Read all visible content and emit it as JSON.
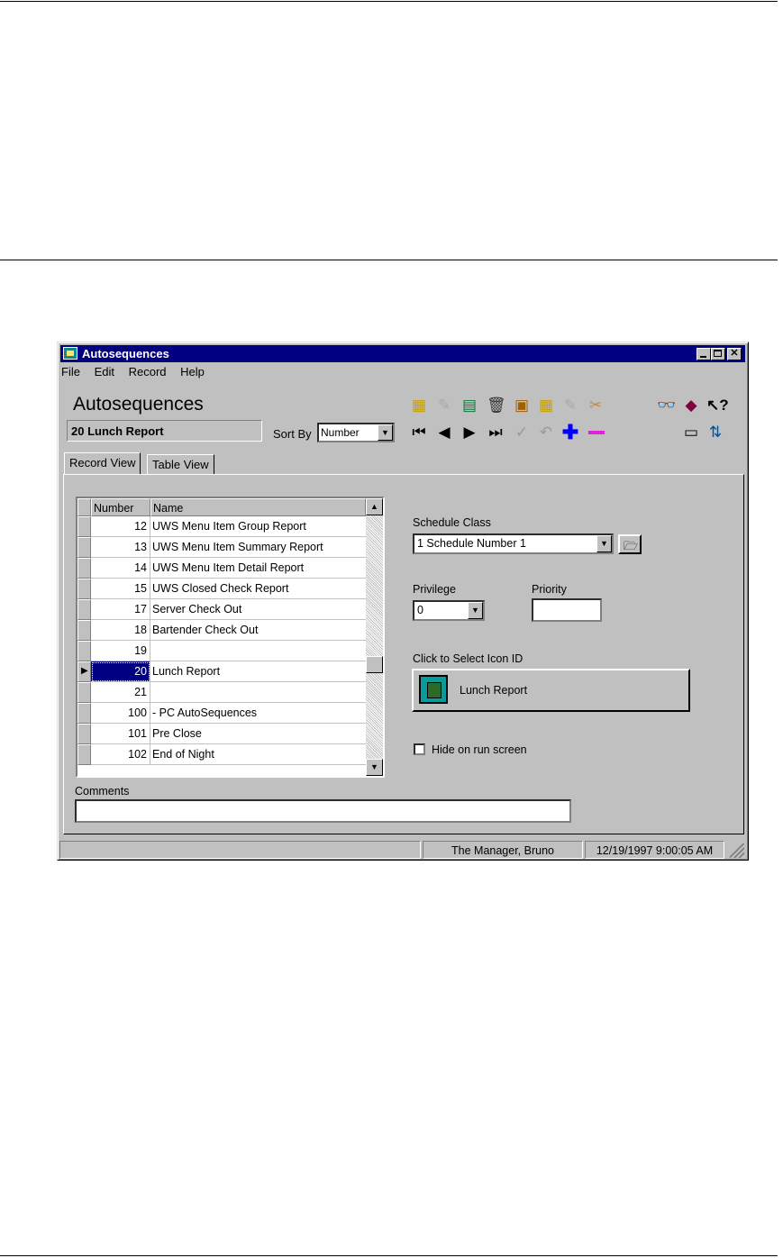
{
  "window": {
    "title": "Autosequences"
  },
  "menu": [
    "File",
    "Edit",
    "Record",
    "Help"
  ],
  "header": {
    "title": "Autosequences",
    "current_record": "20 Lunch Report",
    "sort_label": "Sort By",
    "sort_value": "Number"
  },
  "tabs": [
    {
      "label": "Record View",
      "active": true
    },
    {
      "label": "Table View",
      "active": false
    }
  ],
  "grid": {
    "columns": [
      "Number",
      "Name"
    ],
    "rows": [
      {
        "number": "12",
        "name": "UWS Menu Item Group Report"
      },
      {
        "number": "13",
        "name": "UWS Menu Item Summary Report"
      },
      {
        "number": "14",
        "name": "UWS Menu Item Detail Report"
      },
      {
        "number": "15",
        "name": "UWS Closed Check Report"
      },
      {
        "number": "17",
        "name": "Server Check Out"
      },
      {
        "number": "18",
        "name": "Bartender Check Out"
      },
      {
        "number": "19",
        "name": ""
      },
      {
        "number": "20",
        "name": "Lunch Report",
        "selected": true
      },
      {
        "number": "21",
        "name": ""
      },
      {
        "number": "100",
        "name": "- PC AutoSequences"
      },
      {
        "number": "101",
        "name": "Pre Close"
      },
      {
        "number": "102",
        "name": "End of Night"
      }
    ],
    "scroll_position": 0.62
  },
  "form": {
    "schedule_class_label": "Schedule Class",
    "schedule_class_value": "1  Schedule Number 1",
    "privilege_label": "Privilege",
    "privilege_value": "0",
    "priority_label": "Priority",
    "priority_value": "",
    "icon_label": "Click to Select Icon ID",
    "icon_button_text": "Lunch Report",
    "hide_label": "Hide on run screen",
    "hide_checked": false,
    "comments_label": "Comments",
    "comments_value": ""
  },
  "status": {
    "left": "",
    "user": "The Manager, Bruno",
    "datetime": "12/19/1997 9:00:05 AM"
  },
  "toolbar_icons": [
    "form-icon",
    "edit-icon",
    "report-icon",
    "delete-icon",
    "clipboard-icon",
    "copy-icon",
    "paste-icon",
    "tools-icon",
    "first-record-icon",
    "prev-record-icon",
    "next-record-icon",
    "last-record-icon",
    "confirm-icon",
    "undo-icon",
    "add-icon",
    "remove-icon",
    "find-icon",
    "book-icon",
    "help-icon",
    "screen-icon",
    "sync-icon"
  ],
  "colors": {
    "title_bar": "#000080",
    "window": "#c0c0c0",
    "selection": "#000080"
  }
}
